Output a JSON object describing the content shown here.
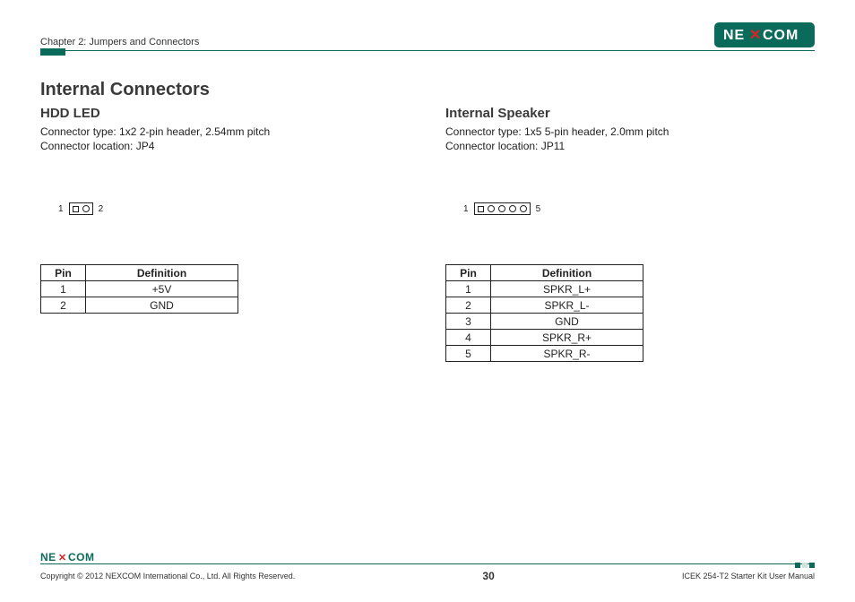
{
  "header": {
    "chapter": "Chapter 2: Jumpers and Connectors",
    "brand_text": "NEXCOM"
  },
  "main": {
    "title": "Internal Connectors",
    "left": {
      "title": "HDD LED",
      "spec1": "Connector type: 1x2 2-pin header, 2.54mm pitch",
      "spec2": "Connector location: JP4",
      "diagram": {
        "left_label": "1",
        "right_label": "2",
        "pins": [
          "sq",
          "o"
        ]
      },
      "table": {
        "headers": [
          "Pin",
          "Definition"
        ],
        "rows": [
          {
            "pin": "1",
            "def": "+5V"
          },
          {
            "pin": "2",
            "def": "GND"
          }
        ]
      }
    },
    "right": {
      "title": "Internal Speaker",
      "spec1": "Connector type: 1x5 5-pin header, 2.0mm pitch",
      "spec2": "Connector location: JP11",
      "diagram": {
        "left_label": "1",
        "right_label": "5",
        "pins": [
          "sq",
          "o",
          "o",
          "o",
          "o"
        ]
      },
      "table": {
        "headers": [
          "Pin",
          "Definition"
        ],
        "rows": [
          {
            "pin": "1",
            "def": "SPKR_L+"
          },
          {
            "pin": "2",
            "def": "SPKR_L-"
          },
          {
            "pin": "3",
            "def": "GND"
          },
          {
            "pin": "4",
            "def": "SPKR_R+"
          },
          {
            "pin": "5",
            "def": "SPKR_R-"
          }
        ]
      }
    }
  },
  "footer": {
    "copyright": "Copyright © 2012 NEXCOM International Co., Ltd. All Rights Reserved.",
    "page": "30",
    "manual": "ICEK 254-T2 Starter Kit User Manual",
    "brand_text": "NEXCOM"
  }
}
